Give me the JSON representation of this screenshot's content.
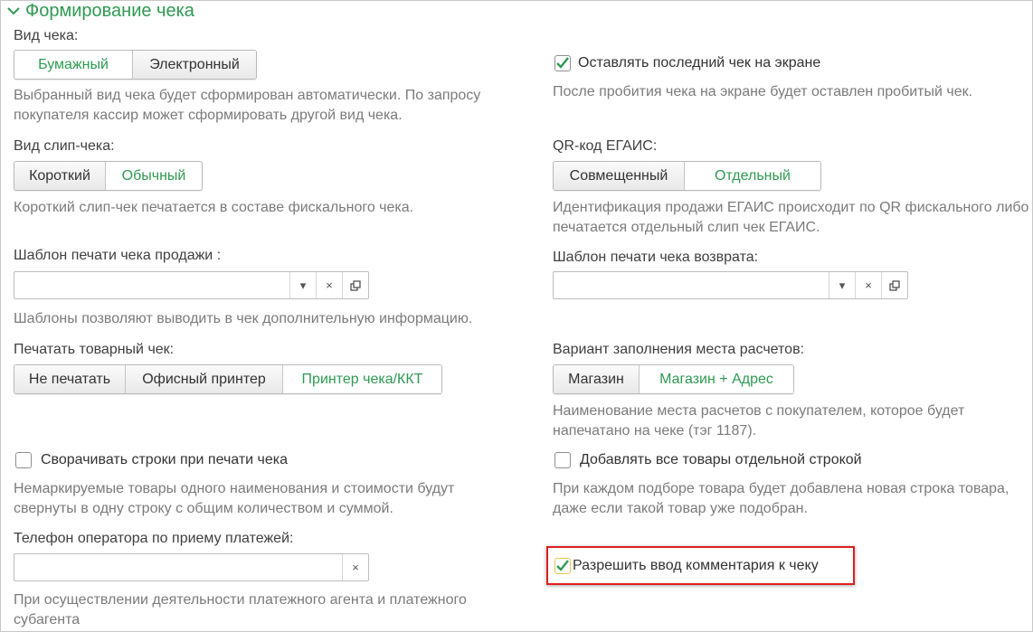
{
  "section": {
    "title": "Формирование чека"
  },
  "left": {
    "receipt_type": {
      "label": "Вид чека:",
      "options": [
        "Бумажный",
        "Электронный"
      ],
      "selected": "Бумажный",
      "hint": "Выбранный вид чека будет сформирован автоматически. По запросу покупателя кассир может сформировать другой вид чека."
    },
    "slip_type": {
      "label": "Вид слип-чека:",
      "options": [
        "Короткий",
        "Обычный"
      ],
      "selected": "Обычный",
      "hint": "Короткий слип-чек печатается  в составе фискального чека."
    },
    "sale_template": {
      "label": "Шаблон печати чека продажи :",
      "value": "",
      "hint": "Шаблоны позволяют выводить в чек дополнительную информацию."
    },
    "print_goods_receipt": {
      "label": "Печатать товарный чек:",
      "options": [
        "Не печатать",
        "Офисный принтер",
        "Принтер чека/ККТ"
      ],
      "selected": "Принтер чека/ККТ"
    },
    "collapse_rows": {
      "label": "Сворачивать строки при печати чека",
      "checked": false,
      "hint": "Немаркируемые товары одного наименования и стоимости будут свернуты в одну строку с общим количеством и суммой."
    },
    "operator_phone": {
      "label": "Телефон оператора по приему платежей:",
      "value": "",
      "hint": "При осуществлении деятельности платежного агента и платежного субагента"
    }
  },
  "right": {
    "keep_last_receipt": {
      "label": "Оставлять последний чек на экране",
      "checked": true,
      "hint": "После пробития чека на экране будет оставлен пробитый чек."
    },
    "egais_qr": {
      "label": "QR-код ЕГАИС:",
      "options": [
        "Совмещенный",
        "Отдельный"
      ],
      "selected": "Отдельный",
      "hint": "Идентификация продажи ЕГАИС происходит по QR фискального либо печатается отдельный слип чек ЕГАИС."
    },
    "return_template": {
      "label": "Шаблон печати чека возврата:",
      "value": ""
    },
    "settlement_place": {
      "label": "Вариант заполнения места расчетов:",
      "options": [
        "Магазин",
        "Магазин + Адрес"
      ],
      "selected": "Магазин + Адрес",
      "hint": "Наименование места расчетов с покупателем, которое будет напечатано на чеке (тэг 1187)."
    },
    "all_items_separate": {
      "label": "Добавлять все товары отдельной строкой",
      "checked": false,
      "hint": "При каждом подборе товара будет добавлена новая строка товара, даже если такой товар уже подобран."
    },
    "allow_comment": {
      "label": "Разрешить ввод комментария к чеку",
      "checked": true
    }
  },
  "icons": {
    "dropdown": "▾",
    "clear": "×",
    "open": "open-window-icon"
  },
  "colors": {
    "accent": "#2f9a52",
    "highlight": "#e01e1e",
    "hint": "#7b7b7b"
  }
}
